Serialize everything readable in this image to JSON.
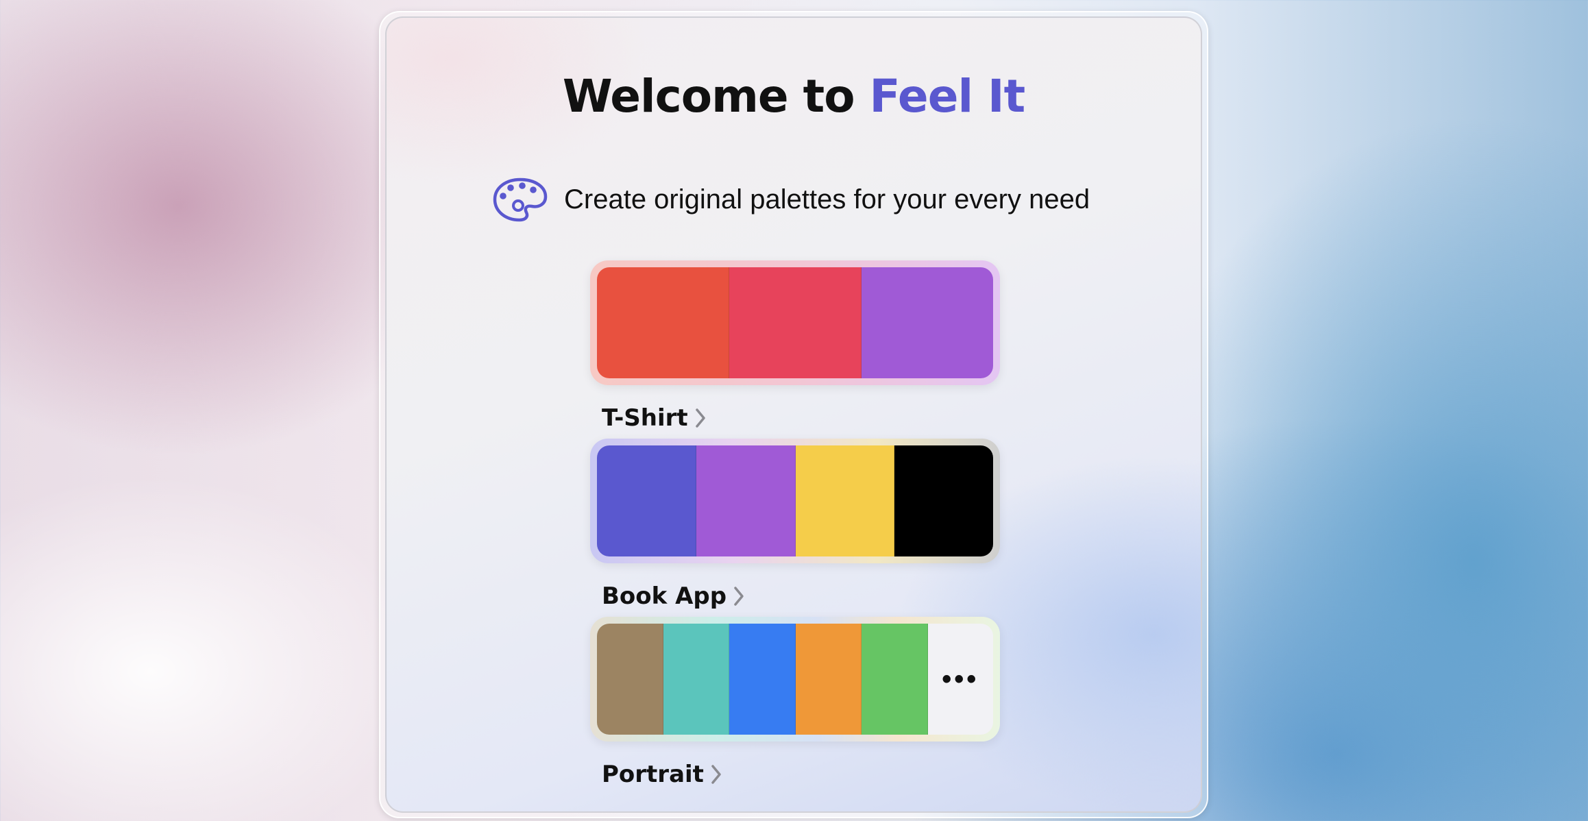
{
  "title": {
    "prefix": "Welcome to",
    "app_name": "Feel It"
  },
  "subtitle": {
    "text": "Create original palettes for your every need",
    "icon": "palette-icon"
  },
  "palettes": [
    {
      "label": "T-Shirt",
      "colors": [
        "#e8513f",
        "#e7435b",
        "#a05ad6"
      ],
      "has_more": false
    },
    {
      "label": "Book App",
      "colors": [
        "#5a58cf",
        "#a05ad6",
        "#f5cd4a",
        "#000000"
      ],
      "has_more": false
    },
    {
      "label": "Portrait",
      "colors": [
        "#9c8462",
        "#5bc5bc",
        "#377cf2",
        "#ef9838",
        "#66c564"
      ],
      "has_more": true,
      "more_glyph": "•••"
    }
  ],
  "colors": {
    "accent": "#5a58cf",
    "text": "#111111"
  },
  "icons": {
    "chevron": "chevron-right-icon"
  }
}
